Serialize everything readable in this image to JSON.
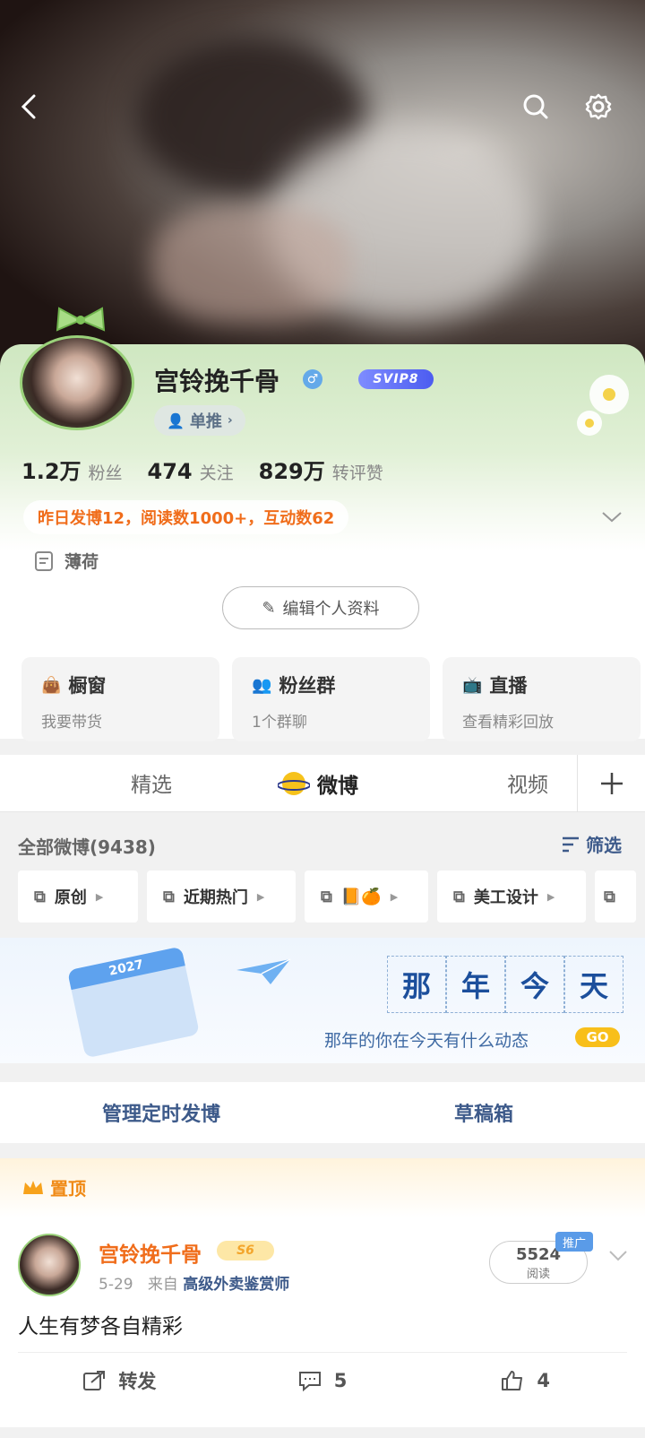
{
  "nav": {
    "back_icon": "chevron-left-icon",
    "search_icon": "search-icon",
    "settings_icon": "gear-icon"
  },
  "profile": {
    "name": "宫铃挽千骨",
    "gender_icon": "male-icon",
    "badge": "SVIP8",
    "support_label": "单推",
    "followers_value": "1.2万",
    "followers_label": "粉丝",
    "following_value": "474",
    "following_label": "关注",
    "likes_value": "829万",
    "likes_label": "转评赞",
    "notice": "昨日发博12，阅读数1000+，互动数62",
    "bio": "薄荷",
    "edit_label": "编辑个人资料"
  },
  "tiles": [
    {
      "title": "橱窗",
      "sub": "我要带货",
      "icon": "bag-icon"
    },
    {
      "title": "粉丝群",
      "sub": "1个群聊",
      "icon": "group-icon"
    },
    {
      "title": "直播",
      "sub": "查看精彩回放",
      "icon": "tv-icon"
    }
  ],
  "tabs": [
    "精选",
    "微博",
    "视频"
  ],
  "feed": {
    "all_label": "全部微博(9438)",
    "filter_label": "筛选",
    "chips": [
      "原创",
      "近期热门",
      "📙🍊",
      "美工设计"
    ]
  },
  "banner": {
    "calendar_year": "2027",
    "chars": [
      "那",
      "年",
      "今",
      "天"
    ],
    "subtitle": "那年的你在今天有什么动态",
    "go_label": "GO"
  },
  "manage": {
    "scheduled": "管理定时发博",
    "drafts": "草稿箱"
  },
  "post": {
    "pin_label": "置顶",
    "author": "宫铃挽千骨",
    "level": "S6",
    "date": "5-29",
    "from_prefix": "来自",
    "source": "高级外卖鉴赏师",
    "reads_value": "5524",
    "reads_label": "阅读",
    "promo_label": "推广",
    "text": "人生有梦各自精彩",
    "repost_label": "转发",
    "comments": "5",
    "likes": "4"
  },
  "colors": {
    "accent_orange": "#f06d1b",
    "link_blue": "#3d5a8a",
    "card_green": "#cfe7c1"
  }
}
